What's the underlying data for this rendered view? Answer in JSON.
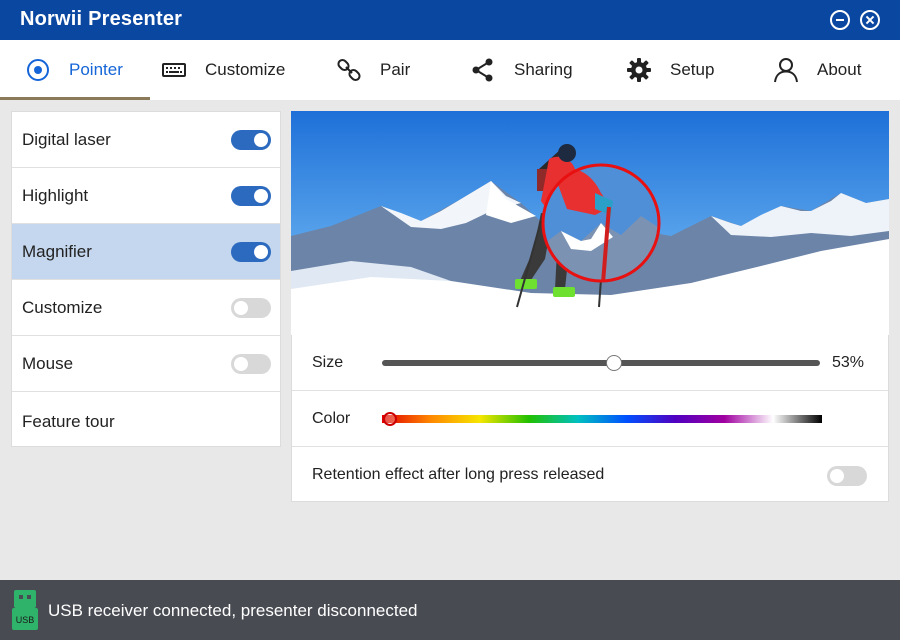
{
  "app": {
    "title": "Norwii Presenter"
  },
  "tabs": [
    {
      "label": "Pointer",
      "icon": "pointer-icon"
    },
    {
      "label": "Customize",
      "icon": "keyboard-icon"
    },
    {
      "label": "Pair",
      "icon": "link-icon"
    },
    {
      "label": "Sharing",
      "icon": "share-icon"
    },
    {
      "label": "Setup",
      "icon": "gear-icon"
    },
    {
      "label": "About",
      "icon": "user-icon"
    }
  ],
  "active_tab": "Pointer",
  "sidebar": {
    "items": [
      {
        "label": "Digital laser",
        "enabled": true
      },
      {
        "label": "Highlight",
        "enabled": true
      },
      {
        "label": "Magnifier",
        "enabled": true,
        "selected": true
      },
      {
        "label": "Customize",
        "enabled": false
      },
      {
        "label": "Mouse",
        "enabled": false
      },
      {
        "label": "Feature tour"
      }
    ]
  },
  "settings": {
    "size": {
      "label": "Size",
      "value": 53,
      "value_text": "53%"
    },
    "color": {
      "label": "Color",
      "selected": "#e00000"
    },
    "retention": {
      "label": "Retention effect after long press released",
      "enabled": false
    }
  },
  "colors": {
    "accent": "#0a47a0",
    "toggle_on": "#2c6ac0",
    "selection": "#c5d7ee",
    "status_bg": "#484b52"
  },
  "status": {
    "text": "USB receiver connected, presenter disconnected",
    "icon": "usb-icon",
    "icon_text": "USB"
  }
}
